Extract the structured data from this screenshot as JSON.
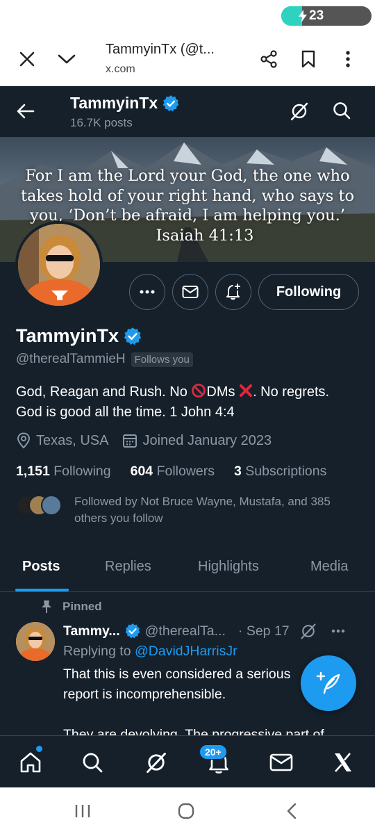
{
  "status_bar": {
    "battery_label": "23",
    "battery_level": 0.23,
    "battery_color": "#2ed3c0"
  },
  "browser": {
    "title": "TammyinTx (@t...",
    "url": "x.com"
  },
  "header": {
    "name": "TammyinTx",
    "posts": "16.7K posts"
  },
  "banner": {
    "lines": [
      "For I am the Lord your God, the one who",
      "takes hold of your right hand, who says to",
      "you, ‘Don’t be afraid, I am helping you.’",
      "Isaiah 41:13"
    ]
  },
  "profile": {
    "follow_button": "Following",
    "display_name": "TammyinTx",
    "handle": "@therealTammieH",
    "follows_you": "Follows you",
    "bio_line1_a": "God, Reagan and Rush. No ",
    "bio_line1_b": "DMs ",
    "bio_line1_c": ". No regrets.",
    "bio_line2": "God is good all the time. 1 John 4:4",
    "location": "Texas, USA",
    "joined": "Joined January 2023",
    "following_count": "1,151",
    "following_label": "Following",
    "followers_count": "604",
    "followers_label": "Followers",
    "subscriptions_count": "3",
    "subscriptions_label": "Subscriptions",
    "followed_by": "Followed by Not Bruce Wayne, Mustafa, and 385 others you follow"
  },
  "tabs": [
    "Posts",
    "Replies",
    "Highlights",
    "Media"
  ],
  "tweet": {
    "pinned_label": "Pinned",
    "name": "Tammy...",
    "handle": "@therealTa...",
    "date": "· Sep 17",
    "replying_prefix": "Replying to ",
    "replying_handle": "@DavidJHarrisJr",
    "body_line1": "That this is even considered a serious",
    "body_line2": "report is incomprehensible.",
    "body_line3": "They are devolving. The progressive part of"
  },
  "bottom_nav": {
    "notification_badge": "20+"
  },
  "colors": {
    "accent": "#1d9bf0",
    "background": "#15202b",
    "muted": "#8b98a5",
    "verified": "#1d9bf0"
  }
}
